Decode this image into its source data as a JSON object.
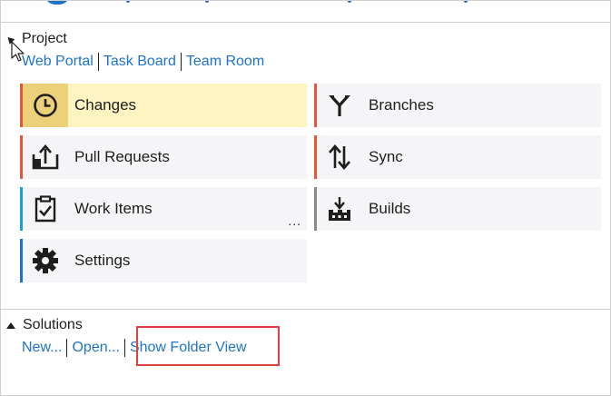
{
  "project": {
    "title": "Project",
    "links": [
      "Web Portal",
      "Task Board",
      "Team Room"
    ]
  },
  "tiles": [
    {
      "label": "Changes",
      "icon": "clock-icon",
      "accent": "#e05a3a",
      "active": true
    },
    {
      "label": "Branches",
      "icon": "branch-icon",
      "accent": "#e05a3a"
    },
    {
      "label": "Pull Requests",
      "icon": "pull-request-icon",
      "accent": "#e05a3a"
    },
    {
      "label": "Sync",
      "icon": "sync-arrows-icon",
      "accent": "#e05a3a"
    },
    {
      "label": "Work Items",
      "icon": "clipboard-check-icon",
      "accent": "#1aa0d8",
      "more": "..."
    },
    {
      "label": "Builds",
      "icon": "builds-icon",
      "accent": "#8a8a8a"
    },
    {
      "label": "Settings",
      "icon": "gear-icon",
      "accent": "#1e73c8"
    }
  ],
  "solutions": {
    "title": "Solutions",
    "links": [
      "New...",
      "Open...",
      "Show Folder View"
    ]
  },
  "colors": {
    "link": "#1e73c8",
    "active_tile": "#fdf4c2",
    "highlight": "#e04040"
  }
}
